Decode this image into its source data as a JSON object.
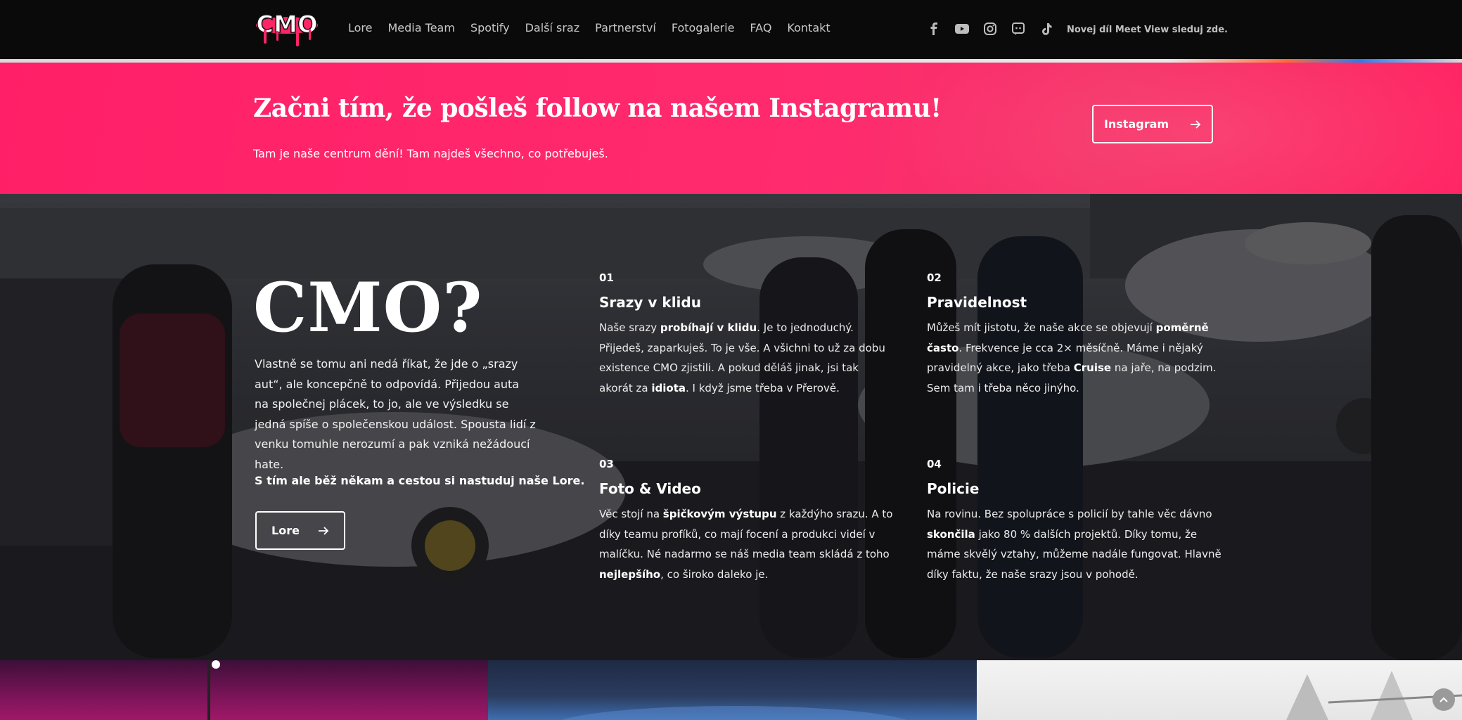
{
  "header": {
    "logo_alt": "CMO",
    "nav": [
      "Lore",
      "Media Team",
      "Spotify",
      "Další sraz",
      "Partnerství",
      "Fotogalerie",
      "FAQ",
      "Kontakt"
    ],
    "social_icons": [
      "facebook-icon",
      "youtube-icon",
      "instagram-icon",
      "discord-icon",
      "tiktok-icon"
    ],
    "meet_text": "Novej díl Meet View sleduj zde."
  },
  "banner": {
    "title": "Začni tím, že pošleš follow na našem Instagramu!",
    "subtitle": "Tam je naše centrum dění! Tam najdeš všechno, co potřebuješ.",
    "button_label": "Instagram",
    "accent": "#ff2466"
  },
  "hero": {
    "title": "CMO?",
    "intro": "Vlastně se tomu ani nedá říkat, že jde o „srazy aut“, ale koncepčně to odpovídá. Přijedou auta na společnej plácek, to jo, ale ve výsledku se jedná spíše o společenskou událost. Spousta lidí z venku tomuhle nerozumí a pak vzniká nežádoucí hate.",
    "intro_bold": "S tím ale běž někam a cestou si nastuduj naše Lore.",
    "button_label": "Lore",
    "features": [
      {
        "num": "01",
        "title": "Srazy v klidu",
        "parts": [
          "Naše srazy ",
          "probíhají v klidu",
          ". Je to jednoduchý. Přijedeš, zaparkuješ. To je vše. A všichni to už za dobu existence CMO zjistili. A pokud děláš jinak, jsi tak akorát za ",
          "idiota",
          ". I když jsme třeba v Přerově."
        ]
      },
      {
        "num": "02",
        "title": "Pravidelnost",
        "parts": [
          "Můžeš mít jistotu, že naše akce se objevují ",
          "poměrně často",
          ". Frekvence je cca 2× měsíčně. Máme i nějaký pravidelný akce, jako třeba ",
          "Cruise",
          " na jaře, na podzim. Sem tam i třeba něco jinýho."
        ]
      },
      {
        "num": "03",
        "title": "Foto & Video",
        "parts": [
          "Věc stojí na ",
          "špičkovým výstupu",
          " z každýho srazu. A to díky teamu profíků, co mají focení a produkci videí v malíčku. Né nadarmo se náš media team skládá z toho ",
          "nejlepšího",
          ", co široko daleko je."
        ]
      },
      {
        "num": "04",
        "title": "Policie",
        "parts": [
          "Na rovinu. Bez spolupráce s policií by tahle věc dávno ",
          "skončila",
          " jako 80 % dalších projektů. Díky tomu, že máme skvělý vztahy, můžeme nadále fungovat. Hlavně díky faktu, že naše srazy jsou v pohodě."
        ]
      }
    ]
  }
}
